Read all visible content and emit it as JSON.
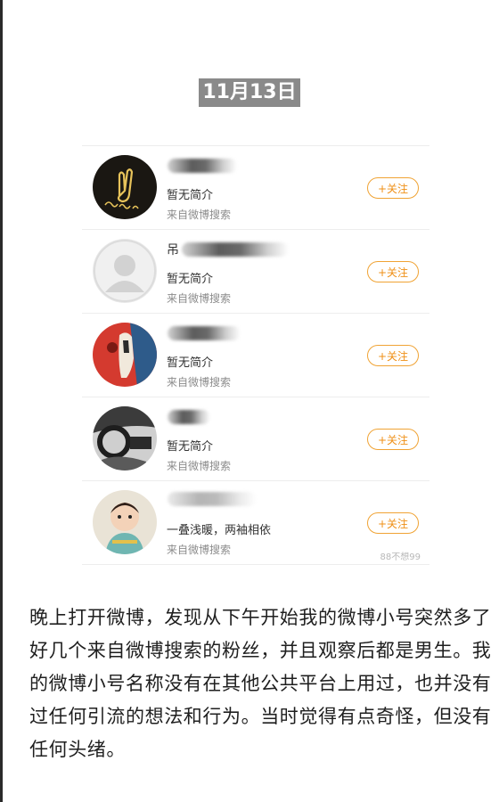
{
  "date_label": "11月13日",
  "follow_label": "+关注",
  "source_label": "来自微博搜索",
  "watermark": "88不想99",
  "followers": [
    {
      "name_visible": "",
      "bio": "暂无简介",
      "avatar": "good-luck-fingers-crossed-neon"
    },
    {
      "name_visible": "吊",
      "bio": "暂无简介",
      "avatar": "default-gray-person"
    },
    {
      "name_visible": "",
      "bio": "暂无简介",
      "avatar": "cartoon-red-blue"
    },
    {
      "name_visible": "",
      "bio": "暂无简介",
      "avatar": "car-interior-photo"
    },
    {
      "name_visible": "",
      "bio": "一叠浅暖，两袖相依",
      "avatar": "toddler-photo"
    }
  ],
  "body_text": "晚上打开微博，发现从下午开始我的微博小号突然多了好几个来自微博搜索的粉丝，并且观察后都是男生。我的微博小号名称没有在其他公共平台上用过，也并没有过任何引流的想法和行为。当时觉得有点奇怪，但没有任何头绪。"
}
